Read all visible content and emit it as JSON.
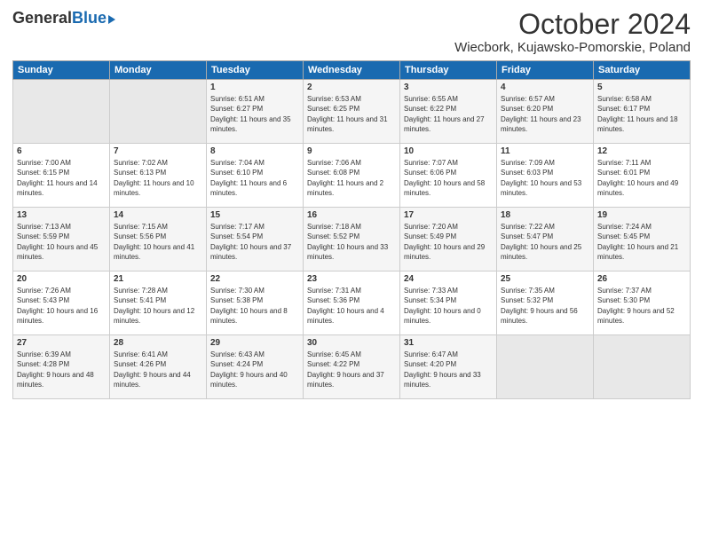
{
  "logo": {
    "general": "General",
    "blue": "Blue"
  },
  "header": {
    "month_year": "October 2024",
    "location": "Wiecbork, Kujawsko-Pomorskie, Poland"
  },
  "days_of_week": [
    "Sunday",
    "Monday",
    "Tuesday",
    "Wednesday",
    "Thursday",
    "Friday",
    "Saturday"
  ],
  "weeks": [
    [
      {
        "num": "",
        "sunrise": "",
        "sunset": "",
        "daylight": "",
        "empty": true
      },
      {
        "num": "",
        "sunrise": "",
        "sunset": "",
        "daylight": "",
        "empty": true
      },
      {
        "num": "1",
        "sunrise": "Sunrise: 6:51 AM",
        "sunset": "Sunset: 6:27 PM",
        "daylight": "Daylight: 11 hours and 35 minutes."
      },
      {
        "num": "2",
        "sunrise": "Sunrise: 6:53 AM",
        "sunset": "Sunset: 6:25 PM",
        "daylight": "Daylight: 11 hours and 31 minutes."
      },
      {
        "num": "3",
        "sunrise": "Sunrise: 6:55 AM",
        "sunset": "Sunset: 6:22 PM",
        "daylight": "Daylight: 11 hours and 27 minutes."
      },
      {
        "num": "4",
        "sunrise": "Sunrise: 6:57 AM",
        "sunset": "Sunset: 6:20 PM",
        "daylight": "Daylight: 11 hours and 23 minutes."
      },
      {
        "num": "5",
        "sunrise": "Sunrise: 6:58 AM",
        "sunset": "Sunset: 6:17 PM",
        "daylight": "Daylight: 11 hours and 18 minutes."
      }
    ],
    [
      {
        "num": "6",
        "sunrise": "Sunrise: 7:00 AM",
        "sunset": "Sunset: 6:15 PM",
        "daylight": "Daylight: 11 hours and 14 minutes."
      },
      {
        "num": "7",
        "sunrise": "Sunrise: 7:02 AM",
        "sunset": "Sunset: 6:13 PM",
        "daylight": "Daylight: 11 hours and 10 minutes."
      },
      {
        "num": "8",
        "sunrise": "Sunrise: 7:04 AM",
        "sunset": "Sunset: 6:10 PM",
        "daylight": "Daylight: 11 hours and 6 minutes."
      },
      {
        "num": "9",
        "sunrise": "Sunrise: 7:06 AM",
        "sunset": "Sunset: 6:08 PM",
        "daylight": "Daylight: 11 hours and 2 minutes."
      },
      {
        "num": "10",
        "sunrise": "Sunrise: 7:07 AM",
        "sunset": "Sunset: 6:06 PM",
        "daylight": "Daylight: 10 hours and 58 minutes."
      },
      {
        "num": "11",
        "sunrise": "Sunrise: 7:09 AM",
        "sunset": "Sunset: 6:03 PM",
        "daylight": "Daylight: 10 hours and 53 minutes."
      },
      {
        "num": "12",
        "sunrise": "Sunrise: 7:11 AM",
        "sunset": "Sunset: 6:01 PM",
        "daylight": "Daylight: 10 hours and 49 minutes."
      }
    ],
    [
      {
        "num": "13",
        "sunrise": "Sunrise: 7:13 AM",
        "sunset": "Sunset: 5:59 PM",
        "daylight": "Daylight: 10 hours and 45 minutes."
      },
      {
        "num": "14",
        "sunrise": "Sunrise: 7:15 AM",
        "sunset": "Sunset: 5:56 PM",
        "daylight": "Daylight: 10 hours and 41 minutes."
      },
      {
        "num": "15",
        "sunrise": "Sunrise: 7:17 AM",
        "sunset": "Sunset: 5:54 PM",
        "daylight": "Daylight: 10 hours and 37 minutes."
      },
      {
        "num": "16",
        "sunrise": "Sunrise: 7:18 AM",
        "sunset": "Sunset: 5:52 PM",
        "daylight": "Daylight: 10 hours and 33 minutes."
      },
      {
        "num": "17",
        "sunrise": "Sunrise: 7:20 AM",
        "sunset": "Sunset: 5:49 PM",
        "daylight": "Daylight: 10 hours and 29 minutes."
      },
      {
        "num": "18",
        "sunrise": "Sunrise: 7:22 AM",
        "sunset": "Sunset: 5:47 PM",
        "daylight": "Daylight: 10 hours and 25 minutes."
      },
      {
        "num": "19",
        "sunrise": "Sunrise: 7:24 AM",
        "sunset": "Sunset: 5:45 PM",
        "daylight": "Daylight: 10 hours and 21 minutes."
      }
    ],
    [
      {
        "num": "20",
        "sunrise": "Sunrise: 7:26 AM",
        "sunset": "Sunset: 5:43 PM",
        "daylight": "Daylight: 10 hours and 16 minutes."
      },
      {
        "num": "21",
        "sunrise": "Sunrise: 7:28 AM",
        "sunset": "Sunset: 5:41 PM",
        "daylight": "Daylight: 10 hours and 12 minutes."
      },
      {
        "num": "22",
        "sunrise": "Sunrise: 7:30 AM",
        "sunset": "Sunset: 5:38 PM",
        "daylight": "Daylight: 10 hours and 8 minutes."
      },
      {
        "num": "23",
        "sunrise": "Sunrise: 7:31 AM",
        "sunset": "Sunset: 5:36 PM",
        "daylight": "Daylight: 10 hours and 4 minutes."
      },
      {
        "num": "24",
        "sunrise": "Sunrise: 7:33 AM",
        "sunset": "Sunset: 5:34 PM",
        "daylight": "Daylight: 10 hours and 0 minutes."
      },
      {
        "num": "25",
        "sunrise": "Sunrise: 7:35 AM",
        "sunset": "Sunset: 5:32 PM",
        "daylight": "Daylight: 9 hours and 56 minutes."
      },
      {
        "num": "26",
        "sunrise": "Sunrise: 7:37 AM",
        "sunset": "Sunset: 5:30 PM",
        "daylight": "Daylight: 9 hours and 52 minutes."
      }
    ],
    [
      {
        "num": "27",
        "sunrise": "Sunrise: 6:39 AM",
        "sunset": "Sunset: 4:28 PM",
        "daylight": "Daylight: 9 hours and 48 minutes."
      },
      {
        "num": "28",
        "sunrise": "Sunrise: 6:41 AM",
        "sunset": "Sunset: 4:26 PM",
        "daylight": "Daylight: 9 hours and 44 minutes."
      },
      {
        "num": "29",
        "sunrise": "Sunrise: 6:43 AM",
        "sunset": "Sunset: 4:24 PM",
        "daylight": "Daylight: 9 hours and 40 minutes."
      },
      {
        "num": "30",
        "sunrise": "Sunrise: 6:45 AM",
        "sunset": "Sunset: 4:22 PM",
        "daylight": "Daylight: 9 hours and 37 minutes."
      },
      {
        "num": "31",
        "sunrise": "Sunrise: 6:47 AM",
        "sunset": "Sunset: 4:20 PM",
        "daylight": "Daylight: 9 hours and 33 minutes."
      },
      {
        "num": "",
        "sunrise": "",
        "sunset": "",
        "daylight": "",
        "empty": true
      },
      {
        "num": "",
        "sunrise": "",
        "sunset": "",
        "daylight": "",
        "empty": true
      }
    ]
  ]
}
